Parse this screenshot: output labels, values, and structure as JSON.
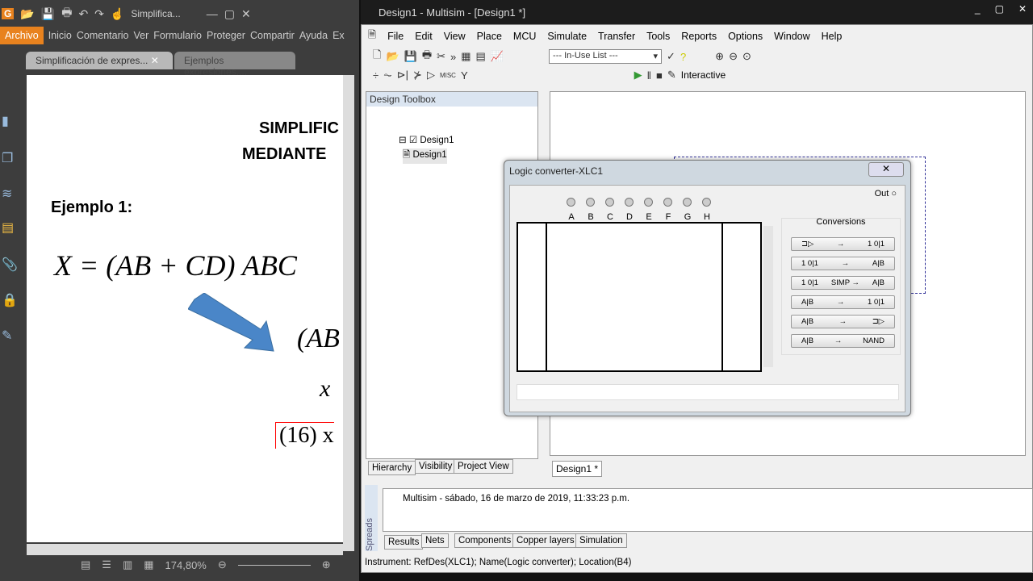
{
  "pdf": {
    "title": "Simplifica...",
    "menu": [
      "Archivo",
      "Inicio",
      "Comentario",
      "Ver",
      "Formulario",
      "Proteger",
      "Compartir",
      "Ayuda",
      "Ex"
    ],
    "tabs": [
      "Simplificación de expres...",
      "Ejemplos expresiones...."
    ],
    "page": {
      "heading1": "SIMPLIFIC",
      "heading2": "MEDIANTE",
      "example": "Ejemplo 1:",
      "equation": "X = (AB + CD) ABC",
      "partial1": "(AB",
      "partial_x": "x",
      "partial2": "(16)  x"
    },
    "zoom": "174,80%"
  },
  "multisim": {
    "title": "Design1 - Multisim - [Design1 *]",
    "menu": [
      "File",
      "Edit",
      "View",
      "Place",
      "MCU",
      "Simulate",
      "Transfer",
      "Tools",
      "Reports",
      "Options",
      "Window",
      "Help"
    ],
    "in_use_list": "--- In-Use List ---",
    "interactive": "Interactive",
    "toolbox": {
      "title": "Design Toolbox",
      "tree_root": "Design1",
      "tree_child": "Design1",
      "tabs": [
        "Hierarchy",
        "Visibility",
        "Project View"
      ]
    },
    "canvas_tab": "Design1 *",
    "spreadsheet": {
      "label": "Spreads",
      "message": "Multisim  -  sábado, 16 de marzo de 2019, 11:33:23 p.m.",
      "tabs": [
        "Results",
        "Nets",
        "Components",
        "Copper layers",
        "Simulation"
      ]
    },
    "status": "Instrument: RefDes(XLC1); Name(Logic converter); Location(B4)",
    "dialog": {
      "title": "Logic converter-XLC1",
      "out": "Out",
      "inputs": [
        "A",
        "B",
        "C",
        "D",
        "E",
        "F",
        "G",
        "H"
      ],
      "conversions_label": "Conversions",
      "buttons": [
        [
          "⊐▷",
          "→",
          "1 0|1"
        ],
        [
          "1 0|1",
          "→",
          "A|B"
        ],
        [
          "1 0|1",
          "SIMP →",
          "A|B"
        ],
        [
          "A|B",
          "→",
          "1 0|1"
        ],
        [
          "A|B",
          "→",
          "⊐▷"
        ],
        [
          "A|B",
          "→",
          "NAND"
        ]
      ]
    }
  }
}
